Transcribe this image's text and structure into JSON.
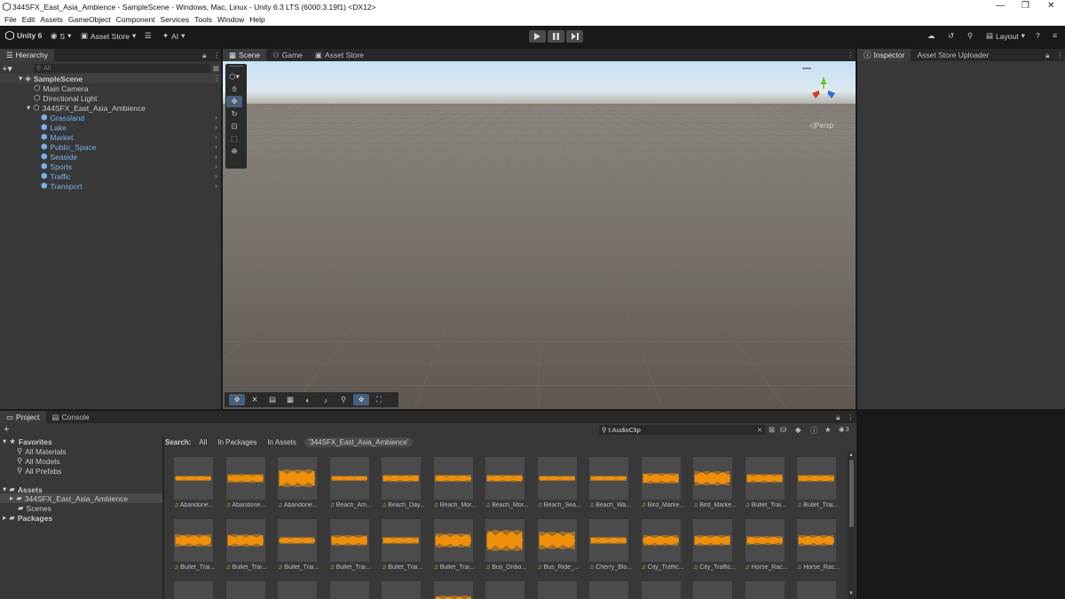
{
  "window": {
    "title": "344SFX_East_Asia_Ambience - SampleScene - Windows, Mac, Linux - Unity 6.3 LTS (6000.3.19f1) <DX12>",
    "controls": {
      "minimize": "—",
      "restore": "❐",
      "close": "✕"
    }
  },
  "menu": [
    "File",
    "Edit",
    "Assets",
    "GameObject",
    "Component",
    "Services",
    "Tools",
    "Window",
    "Help"
  ],
  "toolbar": {
    "unity_label": "Unity 6",
    "account_label": "S",
    "asset_store_label": "Asset Store",
    "ai_label": "AI",
    "layout_label": "Layout"
  },
  "hierarchy": {
    "tab": "Hierarchy",
    "search_placeholder": "All",
    "scene": "SampleScene",
    "items": [
      {
        "label": "Main Camera",
        "blue": false
      },
      {
        "label": "Directional Light",
        "blue": false
      },
      {
        "label": "344SFX_East_Asia_Ambience",
        "blue": false
      }
    ],
    "children": [
      "Grassland",
      "Lake",
      "Market",
      "Public_Space",
      "Seaside",
      "Sports",
      "Traffic",
      "Transport"
    ]
  },
  "scene_tabs": {
    "scene": "Scene",
    "game": "Game",
    "asset_store": "Asset Store"
  },
  "scene": {
    "persp_label": "Persp"
  },
  "inspector_tabs": {
    "inspector": "Inspector",
    "uploader": "Asset Store Uploader"
  },
  "project": {
    "tabs": {
      "project": "Project",
      "console": "Console"
    },
    "search_value": "t:AudioClip",
    "badge_count": "3",
    "search_label": "Search:",
    "scopes": [
      "All",
      "In Packages",
      "In Assets",
      "'344SFX_East_Asia_Ambience'"
    ],
    "favorites": {
      "title": "Favorites",
      "items": [
        "All Materials",
        "All Models",
        "All Prefabs"
      ]
    },
    "assets": {
      "title": "Assets",
      "folders": [
        "344SFX_East_Asia_Ambience",
        "Scenes"
      ]
    },
    "packages": "Packages",
    "row1": [
      "Abandone...",
      "Abandone...",
      "Abandone...",
      "Beach_Am...",
      "Beach_Day...",
      "Beach_Mor...",
      "Beach_Mor...",
      "Beach_Sea...",
      "Beach_Wa...",
      "Bird_Marke...",
      "Bird_Marke...",
      "Bullet_Trai...",
      "Bullet_Trai..."
    ],
    "row2": [
      "Bullet_Trai...",
      "Bullet_Trai...",
      "Bullet_Trai...",
      "Bullet_Trai...",
      "Bullet_Trai...",
      "Bullet_Trai...",
      "Bus_Onbo...",
      "Bus_Ride_...",
      "Cherry_Blo...",
      "City_Traffic...",
      "City_Traffic...",
      "Horse_Rac...",
      "Horse_Rac..."
    ]
  },
  "colors": {
    "accent": "#46607c",
    "waveform": "#f0900a",
    "hierarchy_blue": "#7ab2ef"
  }
}
